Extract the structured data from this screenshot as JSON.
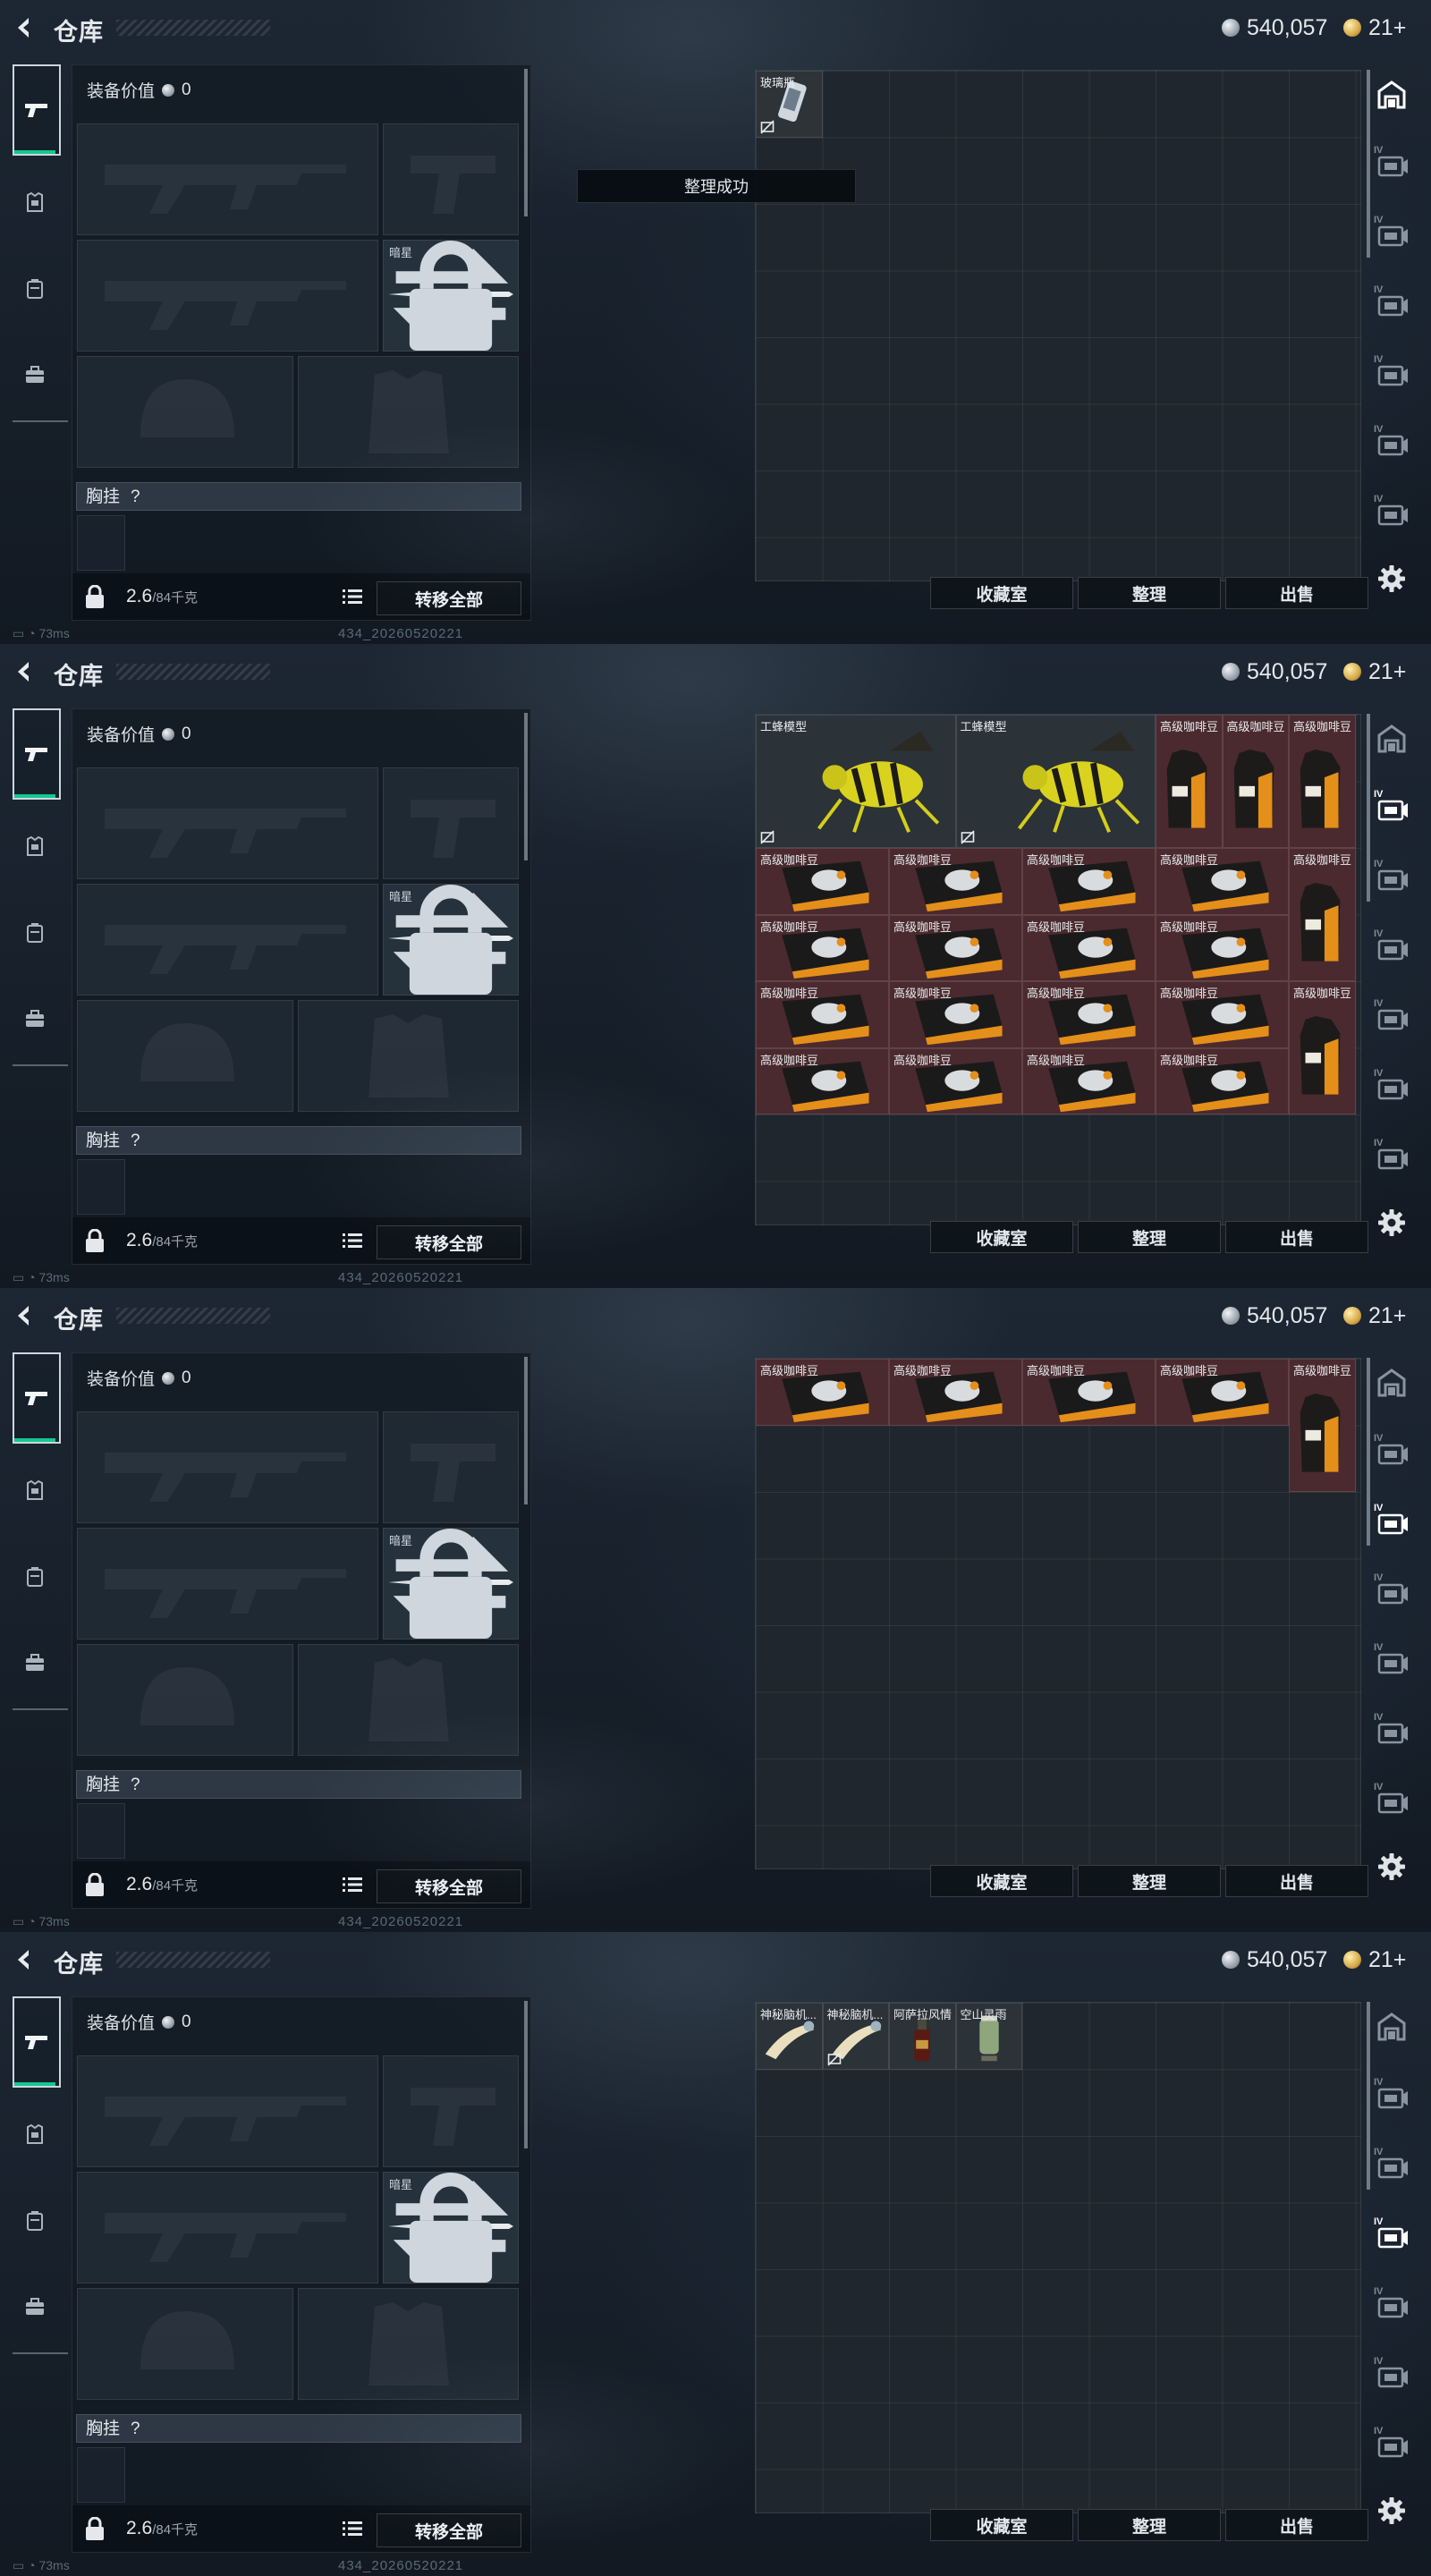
{
  "app": {
    "title": "仓库",
    "currency_silver": "540,057",
    "currency_gold": "21+",
    "status_ping": "73ms",
    "build_id": "434_20260520221",
    "toast": "整理成功"
  },
  "equipment": {
    "value_label": "装备价值",
    "value": "0",
    "melee_label": "暗星",
    "vest_label": "胸挂",
    "vest_help": "?",
    "weight_value": "2.6",
    "weight_max": "/84千克",
    "transfer_all": "转移全部"
  },
  "buttons": {
    "collection": "收藏室",
    "organize": "整理",
    "sell": "出售"
  },
  "left_tabs": [
    "weapon-icon",
    "helmet-icon",
    "backpack-icon",
    "briefcase-icon"
  ],
  "right_tabs": [
    {
      "label": "IV",
      "icon": "warehouse-icon"
    },
    {
      "label": "IV",
      "icon": "storage-page-icon"
    },
    {
      "label": "IV",
      "icon": "storage-page-icon"
    },
    {
      "label": "IV",
      "icon": "storage-page-icon"
    },
    {
      "label": "IV",
      "icon": "storage-page-icon"
    },
    {
      "label": "IV",
      "icon": "storage-page-icon"
    },
    {
      "label": "IV",
      "icon": "storage-page-icon"
    }
  ],
  "panels": [
    {
      "show_toast": true,
      "active_page": 0,
      "items": [
        {
          "name": "玻璃瓶",
          "col": 0,
          "row": 0,
          "w": 1,
          "h": 1,
          "bg": "gray",
          "art": "bottle",
          "nosell": true
        }
      ]
    },
    {
      "show_toast": false,
      "active_page": 1,
      "items": [
        {
          "name": "工蜂模型",
          "col": 0,
          "row": 0,
          "w": 3,
          "h": 2,
          "bg": "dark",
          "art": "bee",
          "nosell": true
        },
        {
          "name": "工蜂模型",
          "col": 3,
          "row": 0,
          "w": 3,
          "h": 2,
          "bg": "dark",
          "art": "bee",
          "nosell": true
        },
        {
          "name": "高级咖啡豆",
          "col": 6,
          "row": 0,
          "w": 1,
          "h": 2,
          "bg": "red",
          "art": "coffee-bag"
        },
        {
          "name": "高级咖啡豆",
          "col": 7,
          "row": 0,
          "w": 1,
          "h": 2,
          "bg": "red",
          "art": "coffee-bag"
        },
        {
          "name": "高级咖啡豆",
          "col": 8,
          "row": 0,
          "w": 1,
          "h": 2,
          "bg": "red",
          "art": "coffee-bag"
        },
        {
          "name": "高级咖啡豆",
          "col": 0,
          "row": 2,
          "w": 2,
          "h": 1,
          "bg": "red",
          "art": "coffee-box"
        },
        {
          "name": "高级咖啡豆",
          "col": 2,
          "row": 2,
          "w": 2,
          "h": 1,
          "bg": "red",
          "art": "coffee-box"
        },
        {
          "name": "高级咖啡豆",
          "col": 4,
          "row": 2,
          "w": 2,
          "h": 1,
          "bg": "red",
          "art": "coffee-box"
        },
        {
          "name": "高级咖啡豆",
          "col": 6,
          "row": 2,
          "w": 2,
          "h": 1,
          "bg": "red",
          "art": "coffee-box"
        },
        {
          "name": "高级咖啡豆",
          "col": 8,
          "row": 2,
          "w": 1,
          "h": 2,
          "bg": "red",
          "art": "coffee-bag"
        },
        {
          "name": "高级咖啡豆",
          "col": 0,
          "row": 3,
          "w": 2,
          "h": 1,
          "bg": "red",
          "art": "coffee-box"
        },
        {
          "name": "高级咖啡豆",
          "col": 2,
          "row": 3,
          "w": 2,
          "h": 1,
          "bg": "red",
          "art": "coffee-box"
        },
        {
          "name": "高级咖啡豆",
          "col": 4,
          "row": 3,
          "w": 2,
          "h": 1,
          "bg": "red",
          "art": "coffee-box"
        },
        {
          "name": "高级咖啡豆",
          "col": 6,
          "row": 3,
          "w": 2,
          "h": 1,
          "bg": "red",
          "art": "coffee-box"
        },
        {
          "name": "高级咖啡豆",
          "col": 0,
          "row": 4,
          "w": 2,
          "h": 1,
          "bg": "red",
          "art": "coffee-box"
        },
        {
          "name": "高级咖啡豆",
          "col": 2,
          "row": 4,
          "w": 2,
          "h": 1,
          "bg": "red",
          "art": "coffee-box"
        },
        {
          "name": "高级咖啡豆",
          "col": 4,
          "row": 4,
          "w": 2,
          "h": 1,
          "bg": "red",
          "art": "coffee-box"
        },
        {
          "name": "高级咖啡豆",
          "col": 6,
          "row": 4,
          "w": 2,
          "h": 1,
          "bg": "red",
          "art": "coffee-box"
        },
        {
          "name": "高级咖啡豆",
          "col": 8,
          "row": 4,
          "w": 1,
          "h": 2,
          "bg": "red",
          "art": "coffee-bag"
        },
        {
          "name": "高级咖啡豆",
          "col": 0,
          "row": 5,
          "w": 2,
          "h": 1,
          "bg": "red",
          "art": "coffee-box"
        },
        {
          "name": "高级咖啡豆",
          "col": 2,
          "row": 5,
          "w": 2,
          "h": 1,
          "bg": "red",
          "art": "coffee-box"
        },
        {
          "name": "高级咖啡豆",
          "col": 4,
          "row": 5,
          "w": 2,
          "h": 1,
          "bg": "red",
          "art": "coffee-box"
        },
        {
          "name": "高级咖啡豆",
          "col": 6,
          "row": 5,
          "w": 2,
          "h": 1,
          "bg": "red",
          "art": "coffee-box"
        }
      ]
    },
    {
      "show_toast": false,
      "active_page": 2,
      "items": [
        {
          "name": "高级咖啡豆",
          "col": 0,
          "row": 0,
          "w": 2,
          "h": 1,
          "bg": "red",
          "art": "coffee-box"
        },
        {
          "name": "高级咖啡豆",
          "col": 2,
          "row": 0,
          "w": 2,
          "h": 1,
          "bg": "red",
          "art": "coffee-box"
        },
        {
          "name": "高级咖啡豆",
          "col": 4,
          "row": 0,
          "w": 2,
          "h": 1,
          "bg": "red",
          "art": "coffee-box"
        },
        {
          "name": "高级咖啡豆",
          "col": 6,
          "row": 0,
          "w": 2,
          "h": 1,
          "bg": "red",
          "art": "coffee-box"
        },
        {
          "name": "高级咖啡豆",
          "col": 8,
          "row": 0,
          "w": 1,
          "h": 2,
          "bg": "red",
          "art": "coffee-bag"
        }
      ]
    },
    {
      "show_toast": false,
      "active_page": 3,
      "items": [
        {
          "name": "神秘脑机...",
          "col": 0,
          "row": 0,
          "w": 1,
          "h": 1,
          "bg": "dark",
          "art": "arm"
        },
        {
          "name": "神秘脑机...",
          "col": 1,
          "row": 0,
          "w": 1,
          "h": 1,
          "bg": "dark",
          "art": "arm",
          "nosell": true
        },
        {
          "name": "阿萨拉风情",
          "col": 2,
          "row": 0,
          "w": 1,
          "h": 1,
          "bg": "dark",
          "art": "bottle-red"
        },
        {
          "name": "空山灵雨",
          "col": 3,
          "row": 0,
          "w": 1,
          "h": 1,
          "bg": "dark",
          "art": "jar-green"
        }
      ]
    }
  ]
}
